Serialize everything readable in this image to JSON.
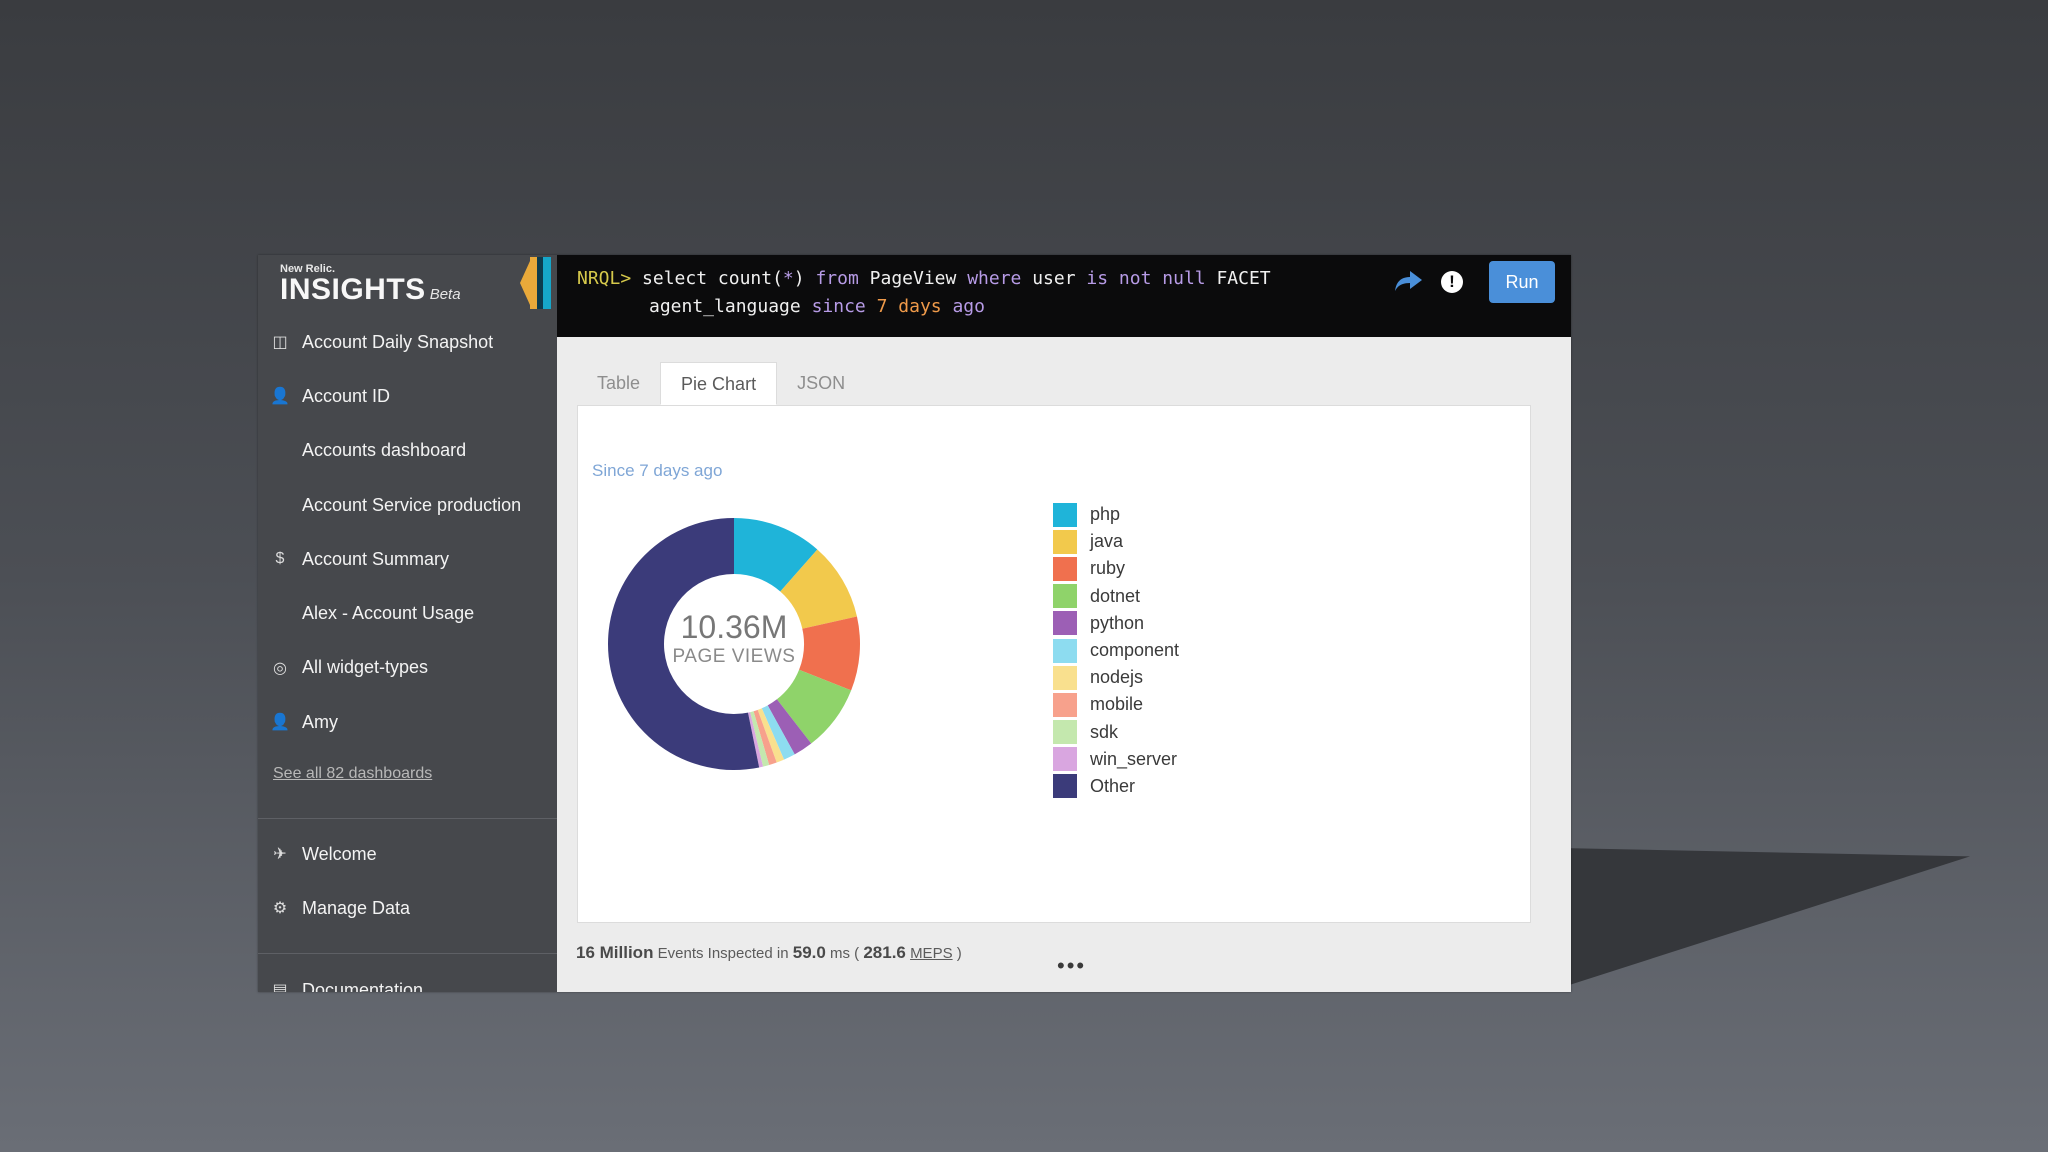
{
  "brand": {
    "maker": "New Relic.",
    "product": "INSIGHTS",
    "tag": "Beta"
  },
  "sidebar": {
    "items": [
      {
        "label": "Account Daily Snapshot",
        "icon": "dashboard-icon"
      },
      {
        "label": "Account ID",
        "icon": "user-icon"
      },
      {
        "label": "Accounts dashboard",
        "icon": ""
      },
      {
        "label": "Account Service production",
        "icon": ""
      },
      {
        "label": "Account Summary",
        "icon": "dollar-icon"
      },
      {
        "label": "Alex - Account Usage",
        "icon": ""
      },
      {
        "label": "All widget-types",
        "icon": "target-icon"
      },
      {
        "label": "Amy",
        "icon": "user-icon"
      }
    ],
    "see_all": "See all 82 dashboards",
    "secondary": [
      {
        "label": "Welcome",
        "icon": "plane-icon"
      },
      {
        "label": "Manage Data",
        "icon": "gears-icon"
      }
    ],
    "documentation": "Documentation"
  },
  "query": {
    "prompt": "NRQL>",
    "line1": [
      {
        "t": "select ",
        "c": "plain"
      },
      {
        "t": "count(",
        "c": "plain"
      },
      {
        "t": "*",
        "c": "kw"
      },
      {
        "t": ") ",
        "c": "plain"
      },
      {
        "t": "from ",
        "c": "kw"
      },
      {
        "t": "PageView ",
        "c": "plain"
      },
      {
        "t": "where ",
        "c": "kw"
      },
      {
        "t": "user ",
        "c": "plain"
      },
      {
        "t": "is not null ",
        "c": "kw"
      },
      {
        "t": "FACET",
        "c": "plain"
      }
    ],
    "line2": [
      {
        "t": "agent_language ",
        "c": "plain"
      },
      {
        "t": "since ",
        "c": "kw"
      },
      {
        "t": "7 days",
        "c": "num"
      },
      {
        "t": " ago",
        "c": "kw"
      }
    ],
    "run_label": "Run"
  },
  "tabs": [
    {
      "label": "Table",
      "active": false
    },
    {
      "label": "Pie Chart",
      "active": true
    },
    {
      "label": "JSON",
      "active": false
    }
  ],
  "chart_data": {
    "type": "pie",
    "subtitle": "Since 7 days ago",
    "center_value": "10.36M",
    "center_label": "PAGE VIEWS",
    "categories": [
      "php",
      "java",
      "ruby",
      "dotnet",
      "python",
      "component",
      "nodejs",
      "mobile",
      "sdk",
      "win_server",
      "Other"
    ],
    "values": [
      11.5,
      10.0,
      9.5,
      8.5,
      2.5,
      1.5,
      1.0,
      1.0,
      0.8,
      0.5,
      53.2
    ],
    "colors": [
      "#1fb4d9",
      "#f2c94c",
      "#f0704e",
      "#8fd36a",
      "#9c5fb5",
      "#8ddcf0",
      "#f9e08e",
      "#f7a18c",
      "#c4e8ae",
      "#d9a6e0",
      "#3b3b7a"
    ]
  },
  "footer": {
    "events": "16 Million",
    "text1": "Events Inspected in",
    "ms": "59.0",
    "text2": "ms (",
    "meps_value": "281.6",
    "meps": "MEPS",
    "close": ")"
  }
}
